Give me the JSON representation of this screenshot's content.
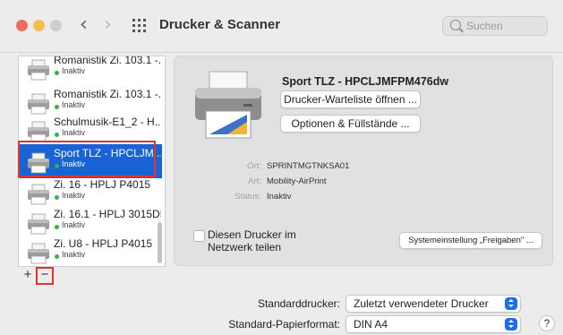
{
  "window": {
    "title": "Drucker & Scanner"
  },
  "search": {
    "placeholder": "Suchen",
    "icon": "search-icon"
  },
  "printers": [
    {
      "name": "Romanistik Zi. 103.1 -...",
      "status": "Inaktiv"
    },
    {
      "name": "Romanistik Zi. 103.1 -...",
      "status": "Inaktiv"
    },
    {
      "name": "Schulmusik-E1_2 - H...",
      "status": "Inaktiv"
    },
    {
      "name": "Sport TLZ - HPCLJM...",
      "status": "Inaktiv",
      "selected": true
    },
    {
      "name": "Zi. 16 - HPLJ P4015",
      "status": "Inaktiv"
    },
    {
      "name": "Zi. 16.1 - HPLJ 3015DN",
      "status": "Inaktiv"
    },
    {
      "name": "Zi. U8 - HPLJ P4015",
      "status": "Inaktiv"
    }
  ],
  "list_controls": {
    "add": "+",
    "remove": "−"
  },
  "detail": {
    "name": "Sport TLZ - HPCLJMFPM476dw",
    "queue_button": "Drucker-Warteliste öffnen ...",
    "options_button": "Optionen & Füllstände ...",
    "location_label": "Ort:",
    "location": "SPRINTMGTNKSA01",
    "kind_label": "Art:",
    "kind": "Mobility-AirPrint",
    "status_label": "Status:",
    "status": "Inaktiv",
    "share_label": "Diesen Drucker im Netzwerk teilen",
    "share_checked": false,
    "sharing_prefs_button": "Systemeinstellung „Freigaben\" ..."
  },
  "defaults": {
    "default_printer_label": "Standarddrucker:",
    "default_printer_value": "Zuletzt verwendeter Drucker",
    "paper_label": "Standard-Papierformat:",
    "paper_value": "DIN A4"
  },
  "help": "?",
  "colors": {
    "selection": "#1863d6",
    "status_dot": "#2fb44a",
    "highlight": "#e0342e",
    "popup_accent": "#1c6fe6"
  }
}
